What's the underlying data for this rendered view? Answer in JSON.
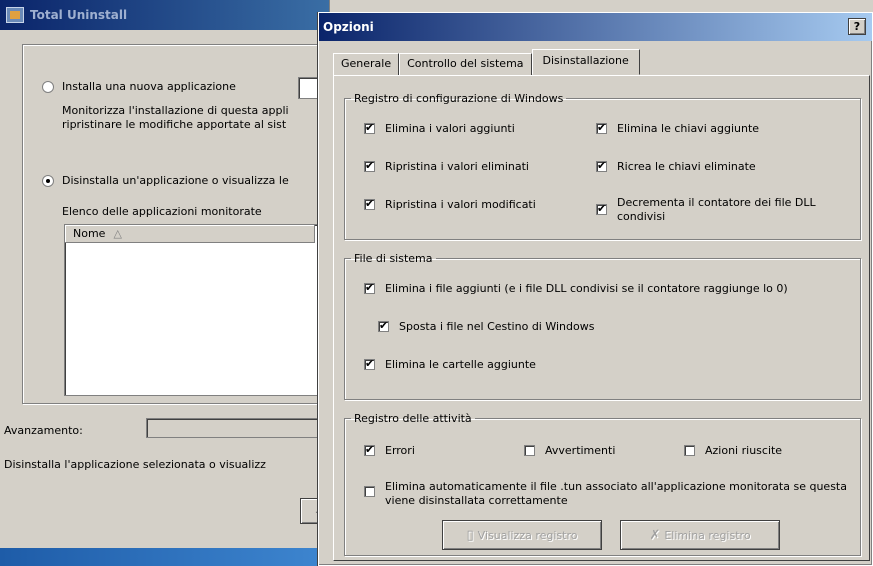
{
  "bg_window": {
    "title": "Total Uninstall",
    "option_install": "Installa una nuova applicazione",
    "install_desc_1": "Monitorizza l'installazione di questa appli",
    "install_desc_2": "ripristinare le modifiche apportate al sist",
    "option_uninstall": "Disinstalla un'applicazione o visualizza le",
    "list_label": "Elenco delle applicazioni monitorate",
    "list_column": "Nome",
    "list_sort_arrow": "△",
    "progress_label": "Avanzamento:",
    "status_text": "Disinstalla l'applicazione selezionata o visualizz",
    "partial_button": "..."
  },
  "dialog": {
    "title": "Opzioni",
    "help_label": "?",
    "tabs": [
      "Generale",
      "Controllo del sistema",
      "Disinstallazione"
    ],
    "active_tab": "Disinstallazione",
    "registry_group": {
      "legend": "Registro di configurazione di Windows",
      "items": [
        {
          "label": "Elimina i valori aggiunti",
          "checked": true
        },
        {
          "label": "Elimina le chiavi aggiunte",
          "checked": true
        },
        {
          "label": "Ripristina i valori eliminati",
          "checked": true
        },
        {
          "label": "Ricrea le chiavi eliminate",
          "checked": true
        },
        {
          "label": "Ripristina i valori modificati",
          "checked": true
        },
        {
          "label": "Decrementa il contatore dei file DLL condivisi",
          "checked": true
        }
      ]
    },
    "files_group": {
      "legend": "File di sistema",
      "items": [
        {
          "label": "Elimina i file aggiunti (e i file DLL condivisi se il contatore raggiunge lo 0)",
          "checked": true
        },
        {
          "label": "Sposta i file nel Cestino di Windows",
          "checked": true
        },
        {
          "label": "Elimina le cartelle aggiunte",
          "checked": true
        }
      ]
    },
    "log_group": {
      "legend": "Registro delle attività",
      "items": [
        {
          "label": "Errori",
          "checked": true
        },
        {
          "label": "Avvertimenti",
          "checked": false
        },
        {
          "label": "Azioni riuscite",
          "checked": false
        },
        {
          "label": "Elimina automaticamente il file .tun associato all'applicazione monitorata se questa viene disinstallata correttamente",
          "checked": false
        }
      ],
      "btn_view": "Visualizza registro",
      "btn_delete": "Elimina registro"
    }
  }
}
